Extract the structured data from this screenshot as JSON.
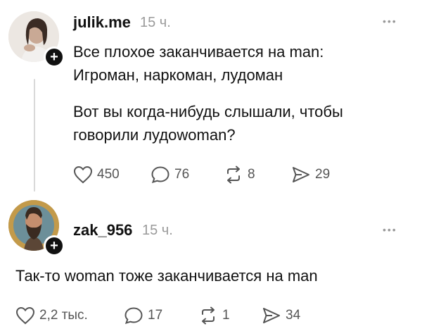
{
  "post1": {
    "username": "julik.me",
    "time": "15 ч.",
    "more_icon": "more-dots-icon",
    "lines": [
      "Все плохое заканчивается на man:",
      "Игроман, наркоман, лудоман",
      "Вот вы когда-нибудь слышали, чтобы",
      "говорили лудоwoman?"
    ],
    "actions": {
      "likes": "450",
      "comments": "76",
      "reposts": "8",
      "shares": "29"
    }
  },
  "post2": {
    "username": "zak_956",
    "time": "15 ч.",
    "more_icon": "more-dots-icon",
    "lines": [
      "Так-то woman тоже заканчивается на man"
    ],
    "actions": {
      "likes": "2,2 тыс.",
      "comments": "17",
      "reposts": "1",
      "shares": "34"
    }
  },
  "colors": {
    "text": "#111111",
    "muted": "#9a9a9a",
    "icon": "#555555",
    "thread_line": "#d9d9d9"
  }
}
